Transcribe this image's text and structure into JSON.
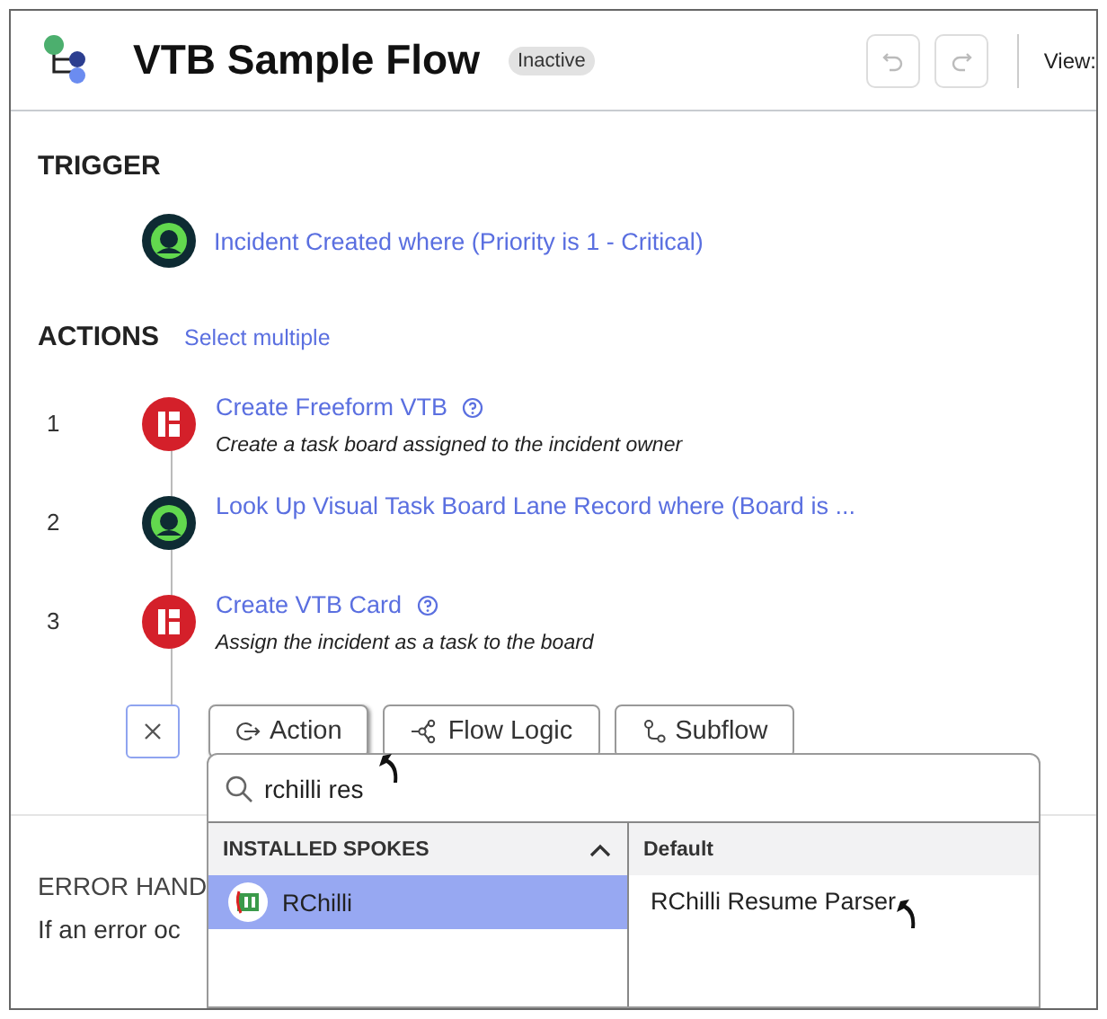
{
  "header": {
    "title": "VTB Sample Flow",
    "status": "Inactive",
    "view_label": "View:"
  },
  "trigger": {
    "heading": "TRIGGER",
    "kind": "record",
    "label": "Incident Created where (Priority is 1 - Critical)"
  },
  "actions": {
    "heading": "ACTIONS",
    "select_link": "Select multiple",
    "steps": [
      {
        "number": "1",
        "kind": "board",
        "label": "Create Freeform VTB",
        "help": true,
        "description": "Create a task board assigned to the incident owner"
      },
      {
        "number": "2",
        "kind": "record",
        "label": "Look Up Visual Task Board Lane Record where (Board is ...",
        "help": false
      },
      {
        "number": "3",
        "kind": "board",
        "label": "Create VTB Card",
        "help": true,
        "description": "Assign the incident as a task to the board"
      }
    ],
    "add_buttons": [
      {
        "kind": "action",
        "label": "Action",
        "selected": true
      },
      {
        "kind": "logic",
        "label": "Flow Logic",
        "selected": false
      },
      {
        "kind": "subflow",
        "label": "Subflow",
        "selected": false
      }
    ]
  },
  "error_handling": {
    "heading": "ERROR HAND",
    "text": "If an error oc"
  },
  "dropdown": {
    "search_value": "rchilli res",
    "left_heading": "INSTALLED SPOKES",
    "expanded": true,
    "spokes": [
      {
        "label": "RChilli",
        "selected": true
      }
    ],
    "right_heading": "Default",
    "results": [
      "RChilli Resume Parser"
    ]
  }
}
